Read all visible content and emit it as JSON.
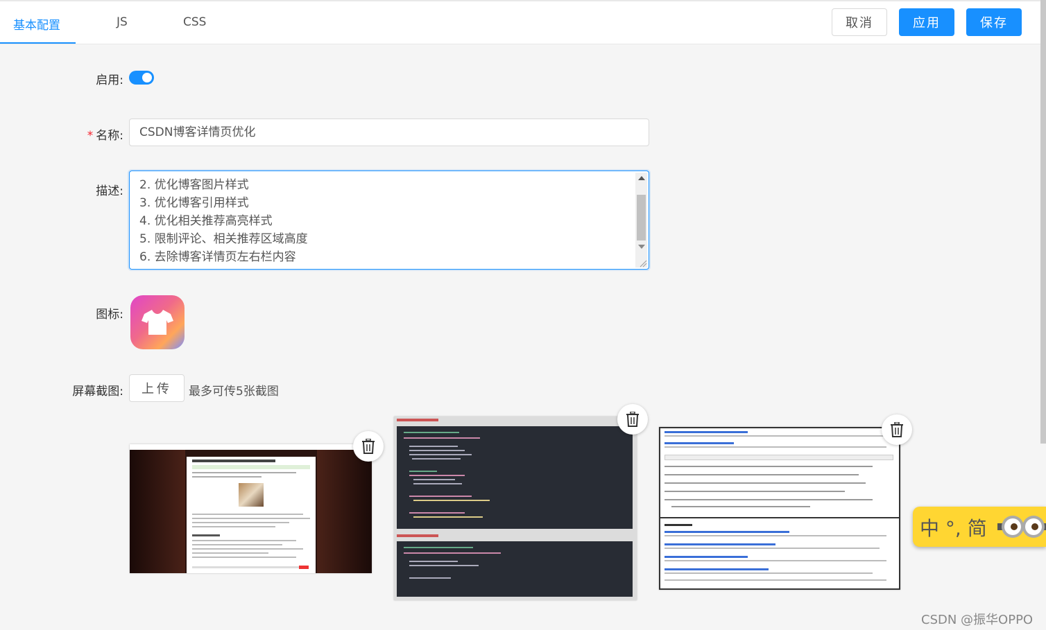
{
  "tabs": [
    {
      "label": "基本配置",
      "active": true
    },
    {
      "label": "JS",
      "active": false
    },
    {
      "label": "CSS",
      "active": false
    }
  ],
  "actions": {
    "cancel": "取消",
    "apply": "应用",
    "save": "保存"
  },
  "form": {
    "enabled_label": "启用:",
    "enabled": true,
    "name_label": "名称:",
    "name_required_mark": "*",
    "name_value": "CSDN博客详情页优化",
    "desc_label": "描述:",
    "desc_lines": [
      "2. 优化博客图片样式",
      "3. 优化博客引用样式",
      "4. 优化相关推荐高亮样式",
      "5. 限制评论、相关推荐区域高度",
      "6. 去除博客详情页左右栏内容"
    ],
    "icon_label": "图标:",
    "icon_name": "tshirt-icon",
    "screenshots_label": "屏幕截图:",
    "upload_label": "上传",
    "upload_hint": "最多可传5张截图"
  },
  "ime": {
    "text": "中 °, 简"
  },
  "watermark": "CSDN @振华OPPO",
  "colors": {
    "accent": "#1890ff",
    "required": "#f5222d",
    "ime_bg": "#ffd632"
  }
}
